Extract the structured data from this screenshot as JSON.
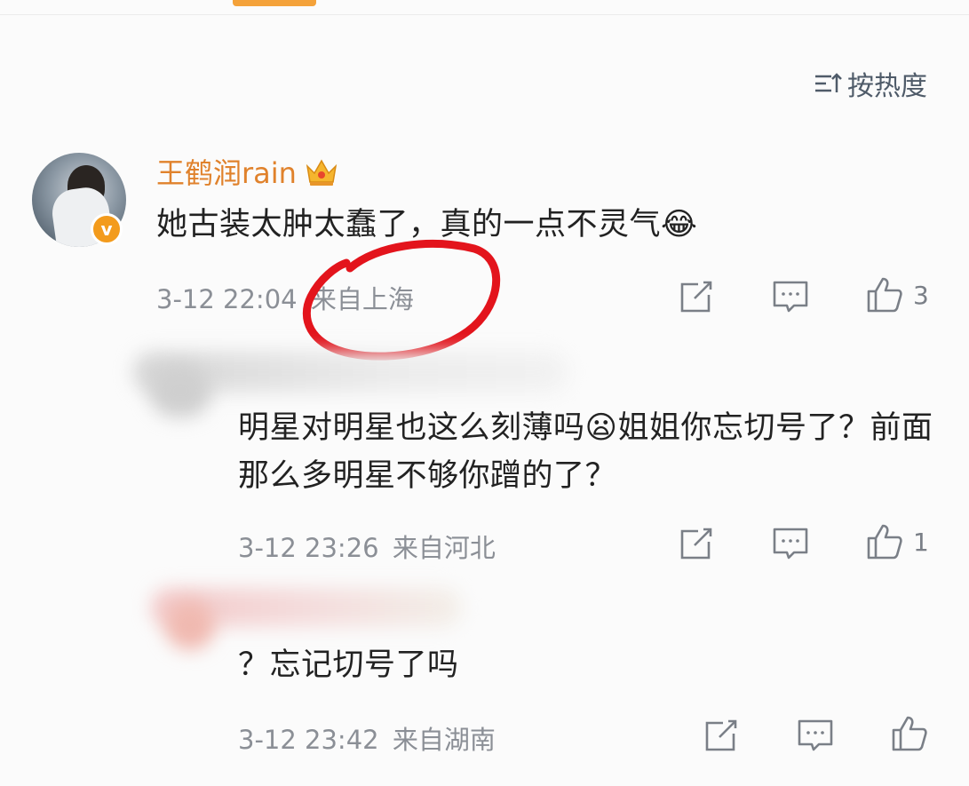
{
  "sort": {
    "label": "按热度"
  },
  "comments": [
    {
      "username": "王鹤润rain",
      "text": "她古装太肿太蠢了，真的一点不灵气😂",
      "time": "3-12 22:04",
      "location": "来自上海",
      "likes": "3"
    },
    {
      "text": "明星对明星也这么刻薄吗😦姐姐你忘切号了？前面那么多明星不够你蹭的了？",
      "time": "3-12 23:26",
      "location": "来自河北",
      "likes": "1"
    },
    {
      "text": "？忘记切号了吗",
      "time": "3-12 23:42",
      "location": "来自湖南",
      "likes": ""
    }
  ],
  "colors": {
    "accent": "#f4a23a",
    "username": "#e0822c",
    "annotation": "#e3141c",
    "meta": "#8b8f96"
  }
}
